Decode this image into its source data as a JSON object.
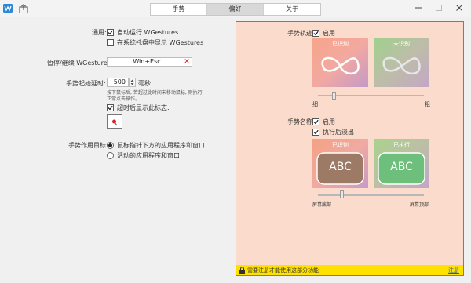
{
  "tabs": [
    {
      "label": "手势"
    },
    {
      "label": "偏好"
    },
    {
      "label": "关于"
    }
  ],
  "general": {
    "label": "通用:",
    "autostart": "自动运行 WGestures",
    "tray": "在系统托盘中显示 WGestures"
  },
  "pause": {
    "label": "暂停/继续 WGestures:",
    "hotkey": "Win+Esc"
  },
  "delay": {
    "label": "手势起始延时:",
    "value": "500",
    "unit": "毫秒",
    "hint_line1": "按下鼠标后, 若超过此时间未移动鼠标, 则执行",
    "hint_line2": "正常点击操作。",
    "show_after_timeout": "超时后显示此标志:"
  },
  "target": {
    "label": "手势作用目标:",
    "option1": "鼠标指针下方的应用程序和窗口",
    "option2": "活动的应用程序和窗口"
  },
  "trail": {
    "label": "手势轨迹:",
    "enable": "启用",
    "recognized": "已识别",
    "unrecognized": "未识别",
    "thin": "细",
    "thick": "粗"
  },
  "name": {
    "label": "手势名称:",
    "enable": "启用",
    "fade": "执行后淡出",
    "recognized": "已识别",
    "executed": "已执行",
    "sample": "ABC",
    "bottom": "屏幕底部",
    "top": "屏幕顶部"
  },
  "notice": {
    "text": "需要注册才能使用这部分功能",
    "link": "注册"
  },
  "colors": {
    "panel_bg": "#fbdccc",
    "panel_border": "#e6504a",
    "notice_bg": "#ffe100",
    "recognized_abc": "#9c7a66",
    "executed_abc": "#6ebf7c"
  }
}
